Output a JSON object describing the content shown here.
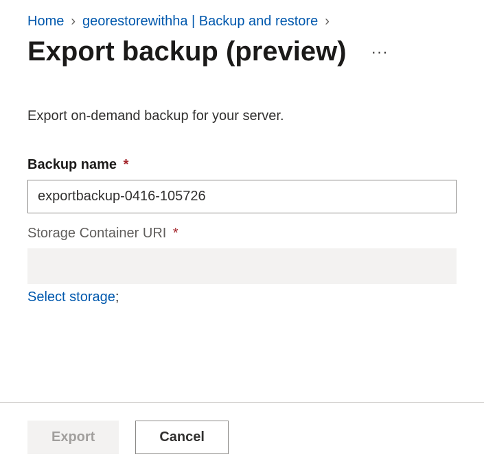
{
  "breadcrumb": {
    "home": "Home",
    "resource": "georestorewithha | Backup and restore"
  },
  "title": "Export backup (preview)",
  "description": "Export on-demand backup for your server.",
  "fields": {
    "backup_name": {
      "label": "Backup name",
      "value": "exportbackup-0416-105726"
    },
    "storage_uri": {
      "label": "Storage Container URI",
      "value": ""
    }
  },
  "link": {
    "select_storage": "Select storage",
    "suffix": ";"
  },
  "buttons": {
    "export": "Export",
    "cancel": "Cancel"
  },
  "required_mark": "*",
  "more_glyph": "···"
}
